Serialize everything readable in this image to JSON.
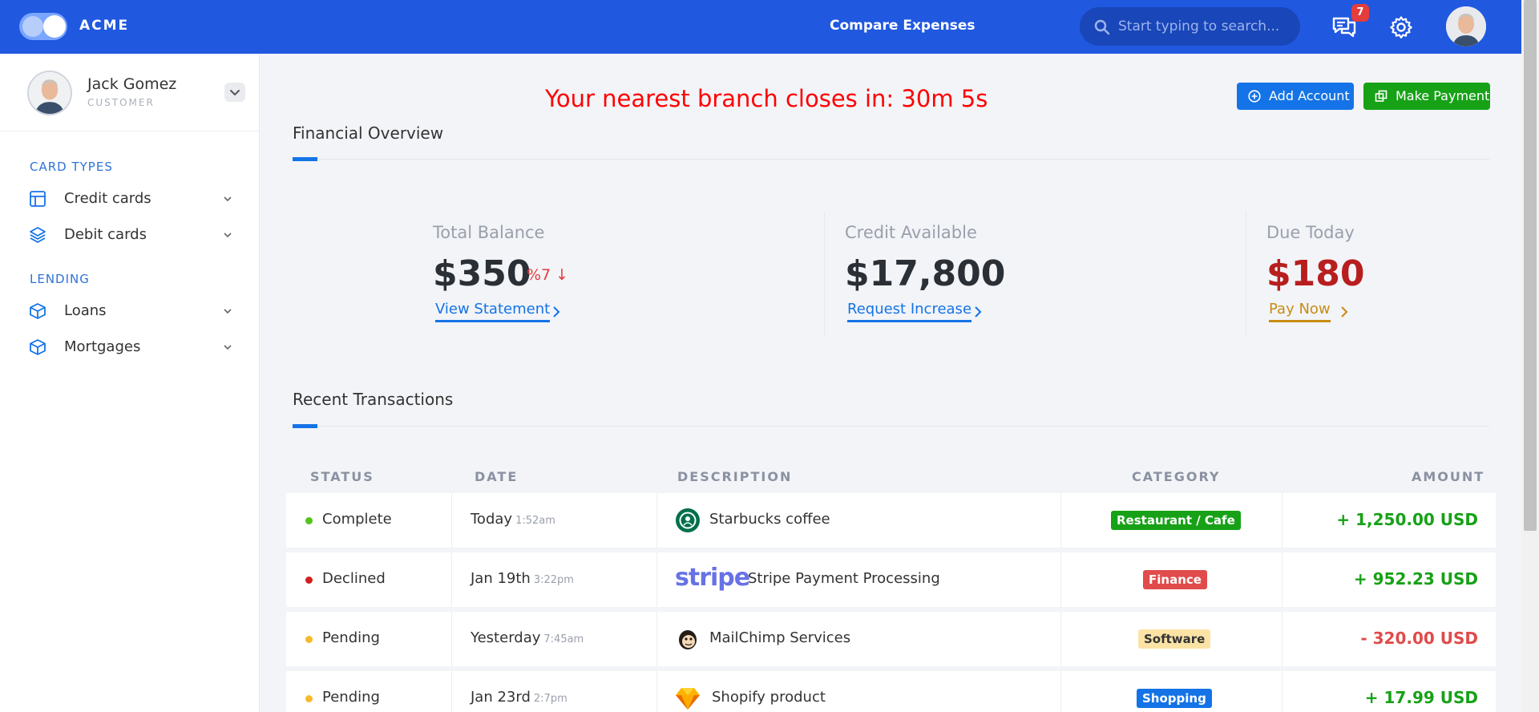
{
  "topbar": {
    "brand": "ACME",
    "title": "Compare Expenses",
    "search_placeholder": "Start typing to search...",
    "notifications_count": "7",
    "icons": [
      "toggle-logo-icon",
      "search-icon",
      "chat-icon",
      "gear-icon",
      "avatar"
    ]
  },
  "user": {
    "name": "Jack Gomez",
    "role": "CUSTOMER"
  },
  "sidebar": {
    "sections": [
      {
        "label": "CARD TYPES",
        "items": [
          {
            "label": "Credit cards",
            "icon": "layout-icon"
          },
          {
            "label": "Debit cards",
            "icon": "layers-icon"
          }
        ]
      },
      {
        "label": "LENDING",
        "items": [
          {
            "label": "Loans",
            "icon": "box-icon"
          },
          {
            "label": "Mortgages",
            "icon": "box-icon"
          }
        ]
      }
    ]
  },
  "main": {
    "countdown": "Your nearest branch closes in: 30m 5s",
    "add_account_label": "Add Account",
    "make_payment_label": "Make Payment",
    "overview_title": "Financial Overview",
    "stats": [
      {
        "label": "Total Balance",
        "value": "$350",
        "change": "%7 ↓",
        "link": "View Statement"
      },
      {
        "label": "Credit Available",
        "value": "$17,800",
        "link": "Request Increase"
      },
      {
        "label": "Due Today",
        "value": "$180",
        "link": "Pay Now"
      }
    ],
    "transactions_title": "Recent Transactions",
    "table": {
      "headers": [
        "STATUS",
        "DATE",
        "DESCRIPTION",
        "CATEGORY",
        "AMOUNT"
      ],
      "rows": [
        {
          "status": "Complete",
          "status_color": "#52c41a",
          "date": "Today",
          "time": "1:52am",
          "logo": "starbucks-logo",
          "description": "Starbucks coffee",
          "category": "Restaurant / Cafe",
          "category_color": "#17a117",
          "amount": "+ 1,250.00 USD",
          "amount_color": "#17a117"
        },
        {
          "status": "Declined",
          "status_color": "#d42020",
          "date": "Jan 19th",
          "time": "3:22pm",
          "logo": "stripe-logo",
          "logo_text": "stripe",
          "description": "Stripe Payment Processing",
          "category": "Finance",
          "category_color": "#e04b4b",
          "amount": "+ 952.23 USD",
          "amount_color": "#17a117"
        },
        {
          "status": "Pending",
          "status_color": "#f7b92b",
          "date": "Yesterday",
          "time": "7:45am",
          "logo": "mailchimp-logo",
          "description": "MailChimp Services",
          "category": "Software",
          "category_color": "#fbe3a6",
          "amount": "- 320.00 USD",
          "amount_color": "#e04b4b"
        },
        {
          "status": "Pending",
          "status_color": "#f7b92b",
          "date": "Jan 23rd",
          "time": "2:7pm",
          "logo": "sketch-logo",
          "description": "Shopify product",
          "category": "Shopping",
          "category_color": "#1473e6",
          "amount": "+ 17.99 USD",
          "amount_color": "#17a117"
        }
      ]
    }
  },
  "colors": {
    "topbar": "#2058e0",
    "accent": "#1473e6",
    "success": "#17a117",
    "danger": "#e53c3c",
    "due": "#b81e1e",
    "pay_now": "#c98b12"
  }
}
